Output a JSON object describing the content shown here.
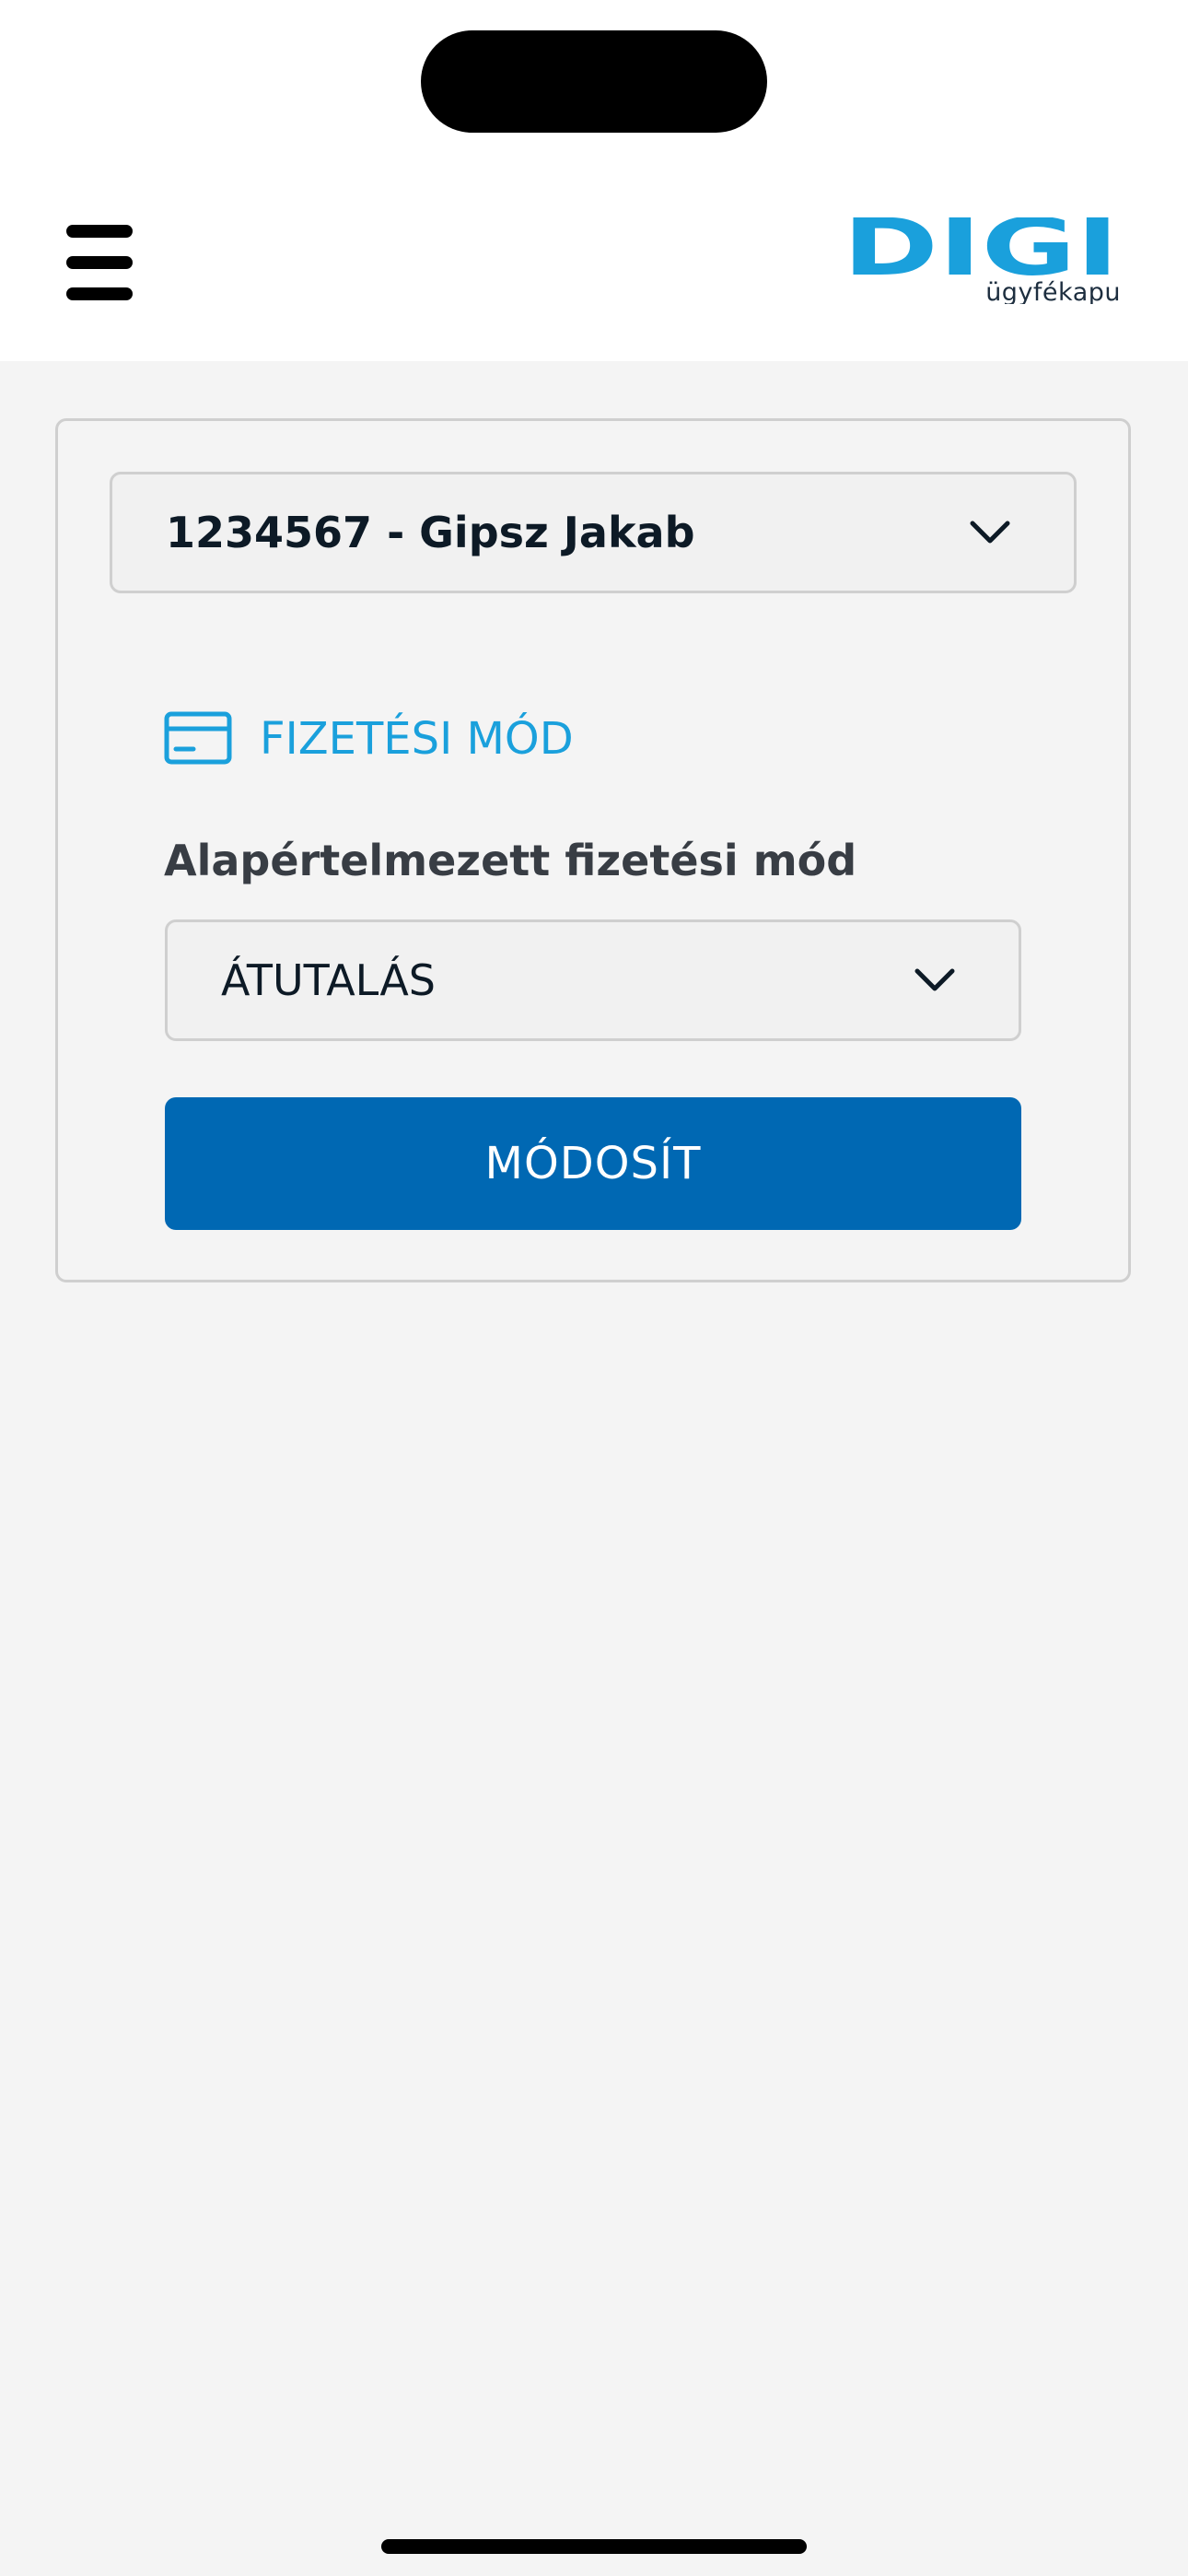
{
  "header": {
    "logo": {
      "wordmark": "DIGI",
      "subtitle": "ügyfékapu",
      "color": "#1aa0dc"
    },
    "menu_icon": "hamburger-menu-icon"
  },
  "account_selector": {
    "value": "1234567 - Gipsz Jakab",
    "icon": "chevron-down-icon"
  },
  "payment_section": {
    "icon": "credit-card-icon",
    "title": "FIZETÉSI MÓD",
    "field_label": "Alapértelmezett fizetési mód",
    "selected_method": "ÁTUTALÁS",
    "submit_label": "MÓDOSÍT"
  },
  "colors": {
    "accent": "#1aa0dc",
    "primary_button": "#0068b3",
    "background": "#f4f4f4"
  }
}
